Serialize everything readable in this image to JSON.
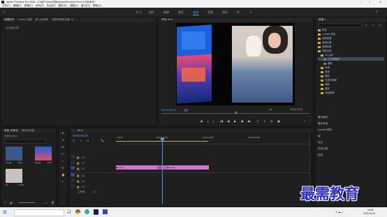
{
  "window": {
    "title": "Adobe Premiere Pro 2020 - C:\\用户\\Jlsvj\\文档\\Adobe\\Premiere Pro\\14.0\\未命名 *",
    "controls": [
      "—",
      "□",
      "✕"
    ]
  },
  "menu": [
    "文件(F)",
    "编辑(E)",
    "剪辑(C)",
    "序列(S)",
    "标记(M)",
    "图形(G)",
    "视图(V)",
    "窗口(W)",
    "帮助(H)"
  ],
  "workspaces": [
    {
      "label": "学习",
      "active": false
    },
    {
      "label": "组件",
      "active": false
    },
    {
      "label": "编辑",
      "active": false
    },
    {
      "label": "颜色",
      "active": false
    },
    {
      "label": "效果",
      "active": true
    },
    {
      "label": "音频",
      "active": false
    },
    {
      "label": "图形",
      "active": false
    },
    {
      "label": "库",
      "active": false
    }
  ],
  "source_panel": {
    "tabs": [
      "效果控件",
      "Lumetri 范围",
      "源: (无剪辑)",
      "音频剪辑混合器: 01"
    ],
    "empty_text": "(未选择剪辑)"
  },
  "program_monitor": {
    "tab": "节目: 01 ≡",
    "timecode": "00:00:05:00",
    "fit": "适合",
    "quality": "1/2",
    "duration": "00:00:10:00"
  },
  "effects_panel": {
    "title": "效果 ≡",
    "items": [
      {
        "label": "预设",
        "level": 0
      },
      {
        "label": "Lumetri 预设",
        "level": 0
      },
      {
        "label": "音频效果",
        "level": 0
      },
      {
        "label": "音频过渡",
        "level": 0
      },
      {
        "label": "视频效果",
        "level": 0
      },
      {
        "label": "视频过渡",
        "level": 0
      },
      {
        "label": "3D 运动",
        "level": 1
      },
      {
        "label": "立方体旋转",
        "level": 2,
        "selected": true
      },
      {
        "label": "翻转",
        "level": 2
      },
      {
        "label": "内滑",
        "level": 1
      },
      {
        "label": "划像",
        "level": 1
      },
      {
        "label": "擦除",
        "level": 1
      },
      {
        "label": "沉浸式视频",
        "level": 1
      },
      {
        "label": "溶解",
        "level": 1
      },
      {
        "label": "缩放",
        "level": 1
      },
      {
        "label": "页面剥落",
        "level": 1
      }
    ],
    "dock": [
      "基本图形",
      "基本声音",
      "Lumetri 颜色",
      "库",
      "标记",
      "历史记录",
      "信息"
    ]
  },
  "project_panel": {
    "tabs": [
      "项目: 未命名",
      "媒体浏览器"
    ],
    "project_name": "未命名.prproj",
    "items": [
      {
        "name": "01.jpg",
        "duration": "5:00"
      },
      {
        "name": "02.jpg",
        "duration": "5:00"
      },
      {
        "name": "01",
        "duration": "10:00"
      }
    ]
  },
  "timeline": {
    "tab": "01 ≡",
    "timecode": "00:00:05:00",
    "ruler": [
      "00:00",
      "00:00:05:00",
      "00:00:10:00",
      "00:00:15:00"
    ],
    "tracks": [
      "V3",
      "V2",
      "V1",
      "A1",
      "A2",
      "A3",
      "主声道"
    ],
    "master_value": "0.0",
    "clips": [
      {
        "label": "01.jpg",
        "track": "V1"
      },
      {
        "label": "02.jpg",
        "track": "V1"
      }
    ],
    "transition_label": "立方"
  },
  "watermark": "最需教育",
  "taskbar": {
    "time": "16:06",
    "date": "2021/10/15"
  }
}
